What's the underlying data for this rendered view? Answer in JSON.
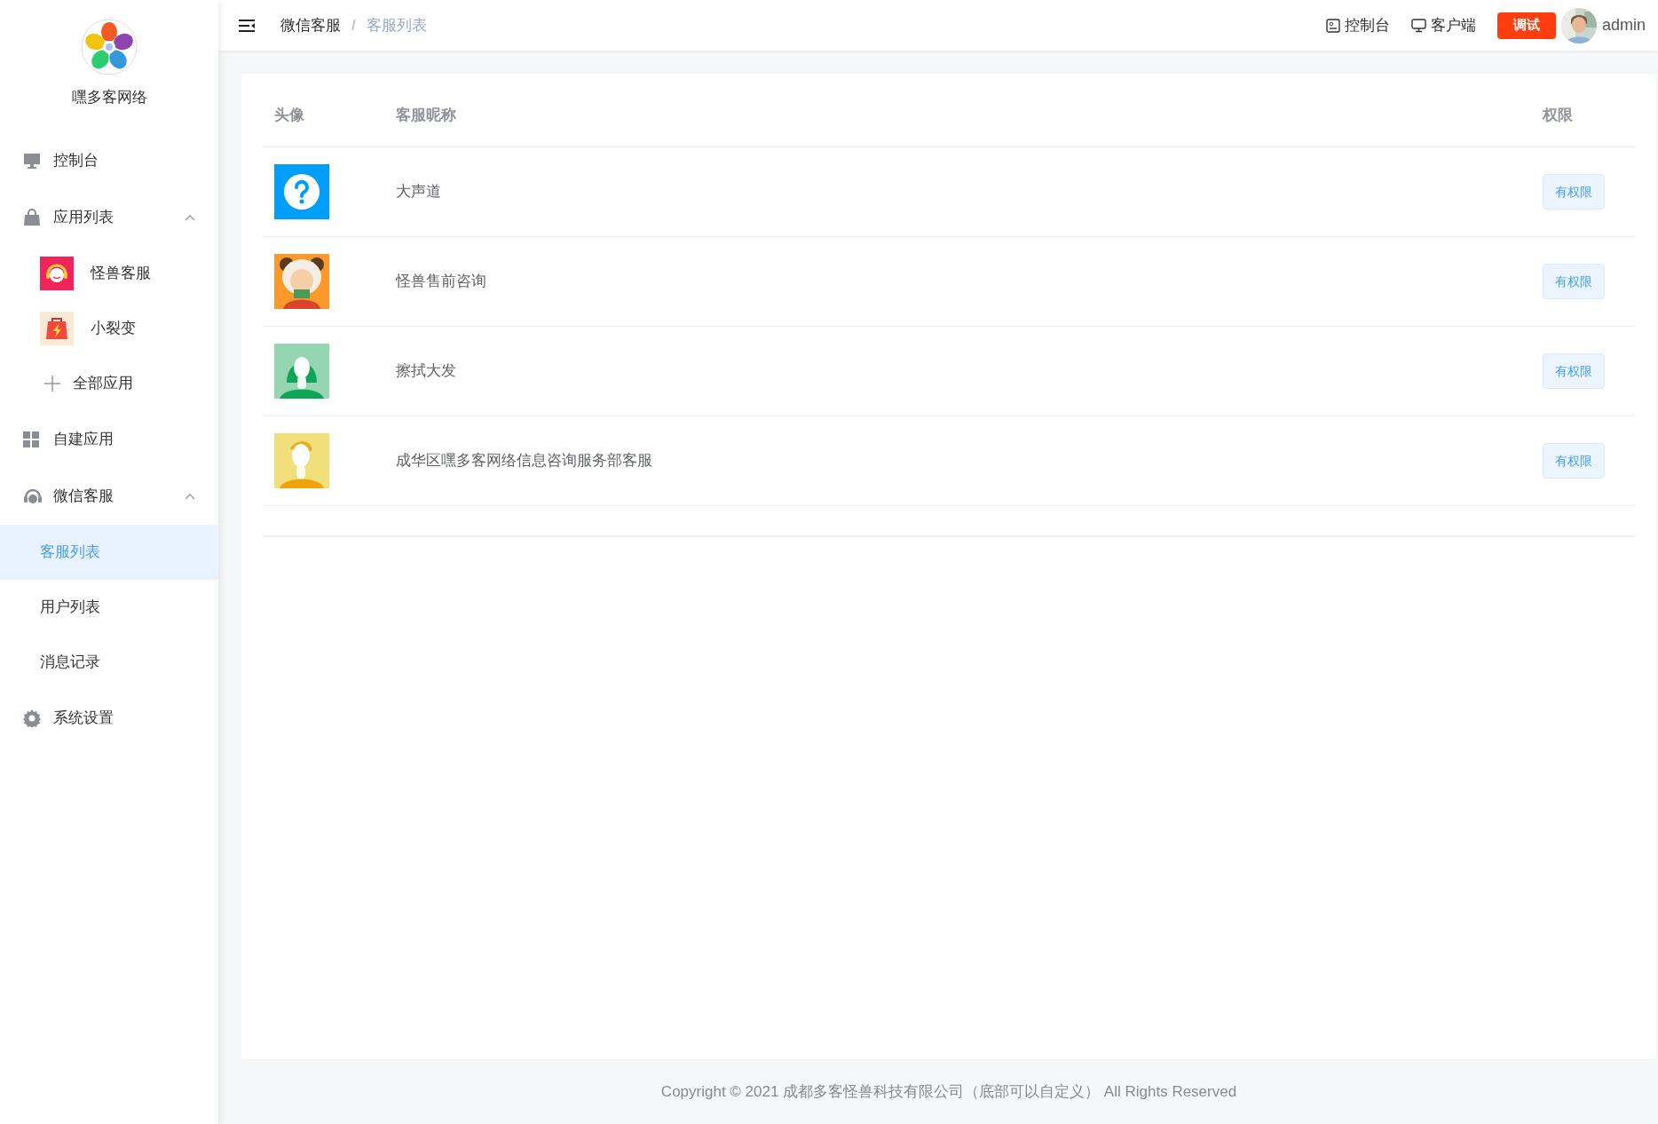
{
  "sidebar": {
    "brand": "嘿多客网络",
    "items": [
      {
        "kind": "item",
        "label": "控制台",
        "selected": false
      },
      {
        "kind": "group",
        "label": "应用列表",
        "selected": false,
        "expanded": true,
        "children": [
          {
            "kind": "app",
            "label": "怪兽客服",
            "selected": false
          },
          {
            "kind": "app",
            "label": "小裂变",
            "selected": false
          },
          {
            "kind": "add",
            "label": "全部应用",
            "selected": false
          }
        ]
      },
      {
        "kind": "item",
        "label": "自建应用",
        "selected": false
      },
      {
        "kind": "group",
        "label": "微信客服",
        "selected": false,
        "expanded": true,
        "children": [
          {
            "kind": "sub",
            "label": "客服列表",
            "selected": true
          },
          {
            "kind": "sub",
            "label": "用户列表",
            "selected": false
          },
          {
            "kind": "sub",
            "label": "消息记录",
            "selected": false
          }
        ]
      },
      {
        "kind": "item",
        "label": "系统设置",
        "selected": false
      }
    ]
  },
  "header": {
    "breadcrumb": [
      "微信客服",
      "客服列表"
    ],
    "separator": "/",
    "actions": [
      "控制台",
      "客户端"
    ],
    "debug_button": "调试",
    "user": "admin"
  },
  "table": {
    "columns": [
      "头像",
      "客服昵称",
      "权限"
    ],
    "rows": [
      {
        "avatar": {
          "kind": "icon"
        },
        "nickname": "大声道",
        "permission": "有权限"
      },
      {
        "nickname": "怪兽售前咨询",
        "permission": "有权限"
      },
      {
        "nickname": "擦拭大发",
        "permission": "有权限"
      },
      {
        "nickname": "成华区嘿多客网络信息咨询服务部客服",
        "permission": "有权限"
      }
    ]
  },
  "footer": "Copyright © 2021 成都多客怪兽科技有限公司（底部可以自定义） All Rights Reserved"
}
